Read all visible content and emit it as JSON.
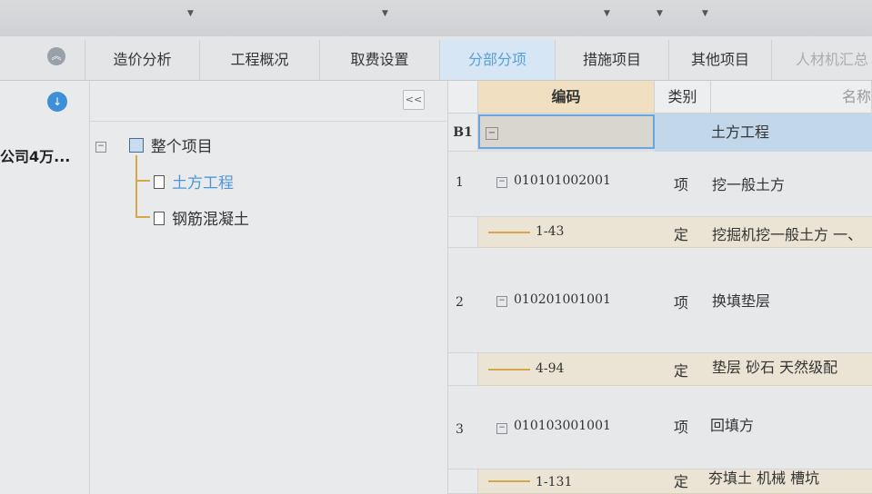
{
  "tabs": [
    {
      "label": "造价分析"
    },
    {
      "label": "工程概况"
    },
    {
      "label": "取费设置"
    },
    {
      "label": "分部分项"
    },
    {
      "label": "措施项目"
    },
    {
      "label": "其他项目"
    },
    {
      "label": "人材机汇总"
    }
  ],
  "active_tab": "分部分项",
  "left": {
    "company": "公司4万..."
  },
  "tree": {
    "collapse_label": "<<",
    "root": "整个项目",
    "children": [
      {
        "label": "土方工程",
        "selected": true
      },
      {
        "label": "钢筋混凝土",
        "selected": false
      }
    ]
  },
  "grid": {
    "headers": {
      "code": "编码",
      "type": "类别",
      "name": "名称"
    },
    "division": {
      "rownum": "B1",
      "code": "",
      "name": "土方工程"
    },
    "rows": [
      {
        "rownum": "1",
        "code": "010101002001",
        "type": "项",
        "name": "挖一般土方"
      },
      {
        "rownum": "",
        "code": "1-43",
        "type": "定",
        "name": "挖掘机挖一般土方 一、"
      },
      {
        "rownum": "2",
        "code": "010201001001",
        "type": "项",
        "name": "换填垫层"
      },
      {
        "rownum": "",
        "code": "4-94",
        "type": "定",
        "name": "垫层 砂石 天然级配"
      },
      {
        "rownum": "3",
        "code": "010103001001",
        "type": "项",
        "name": "回填方"
      },
      {
        "rownum": "",
        "code": "1-131",
        "type": "定",
        "name": "夯填土 机械 槽坑"
      }
    ]
  },
  "colors": {
    "accent": "#4d96d6",
    "code_header": "#f1dfc2",
    "quota_row": "#ebe4d5",
    "tree_line": "#d4a74a"
  }
}
